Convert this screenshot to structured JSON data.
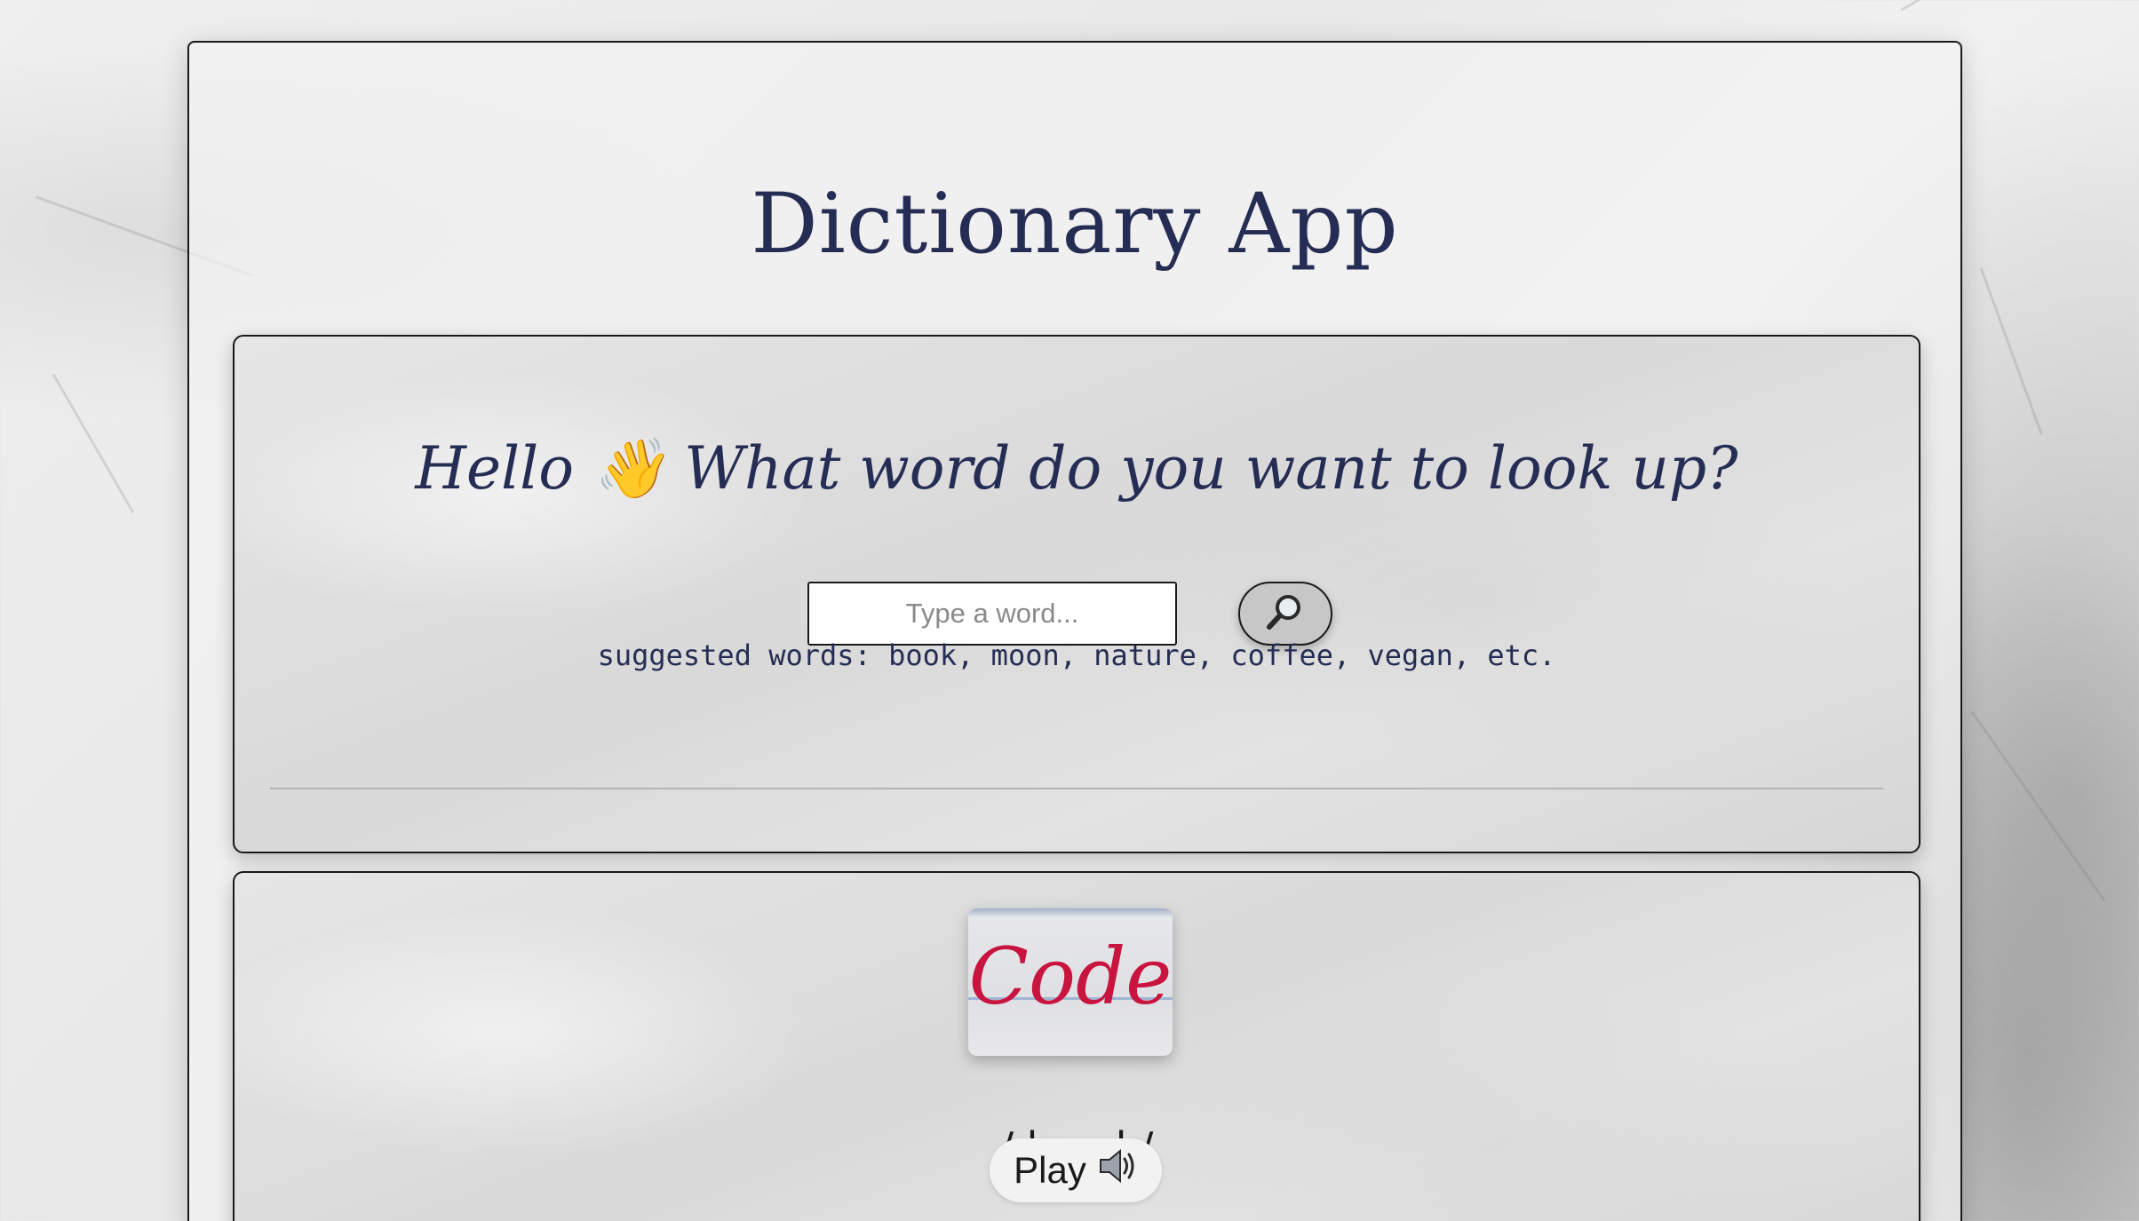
{
  "app": {
    "title": "Dictionary App"
  },
  "search": {
    "greeting": "Hello 👋 What word do you want to look up?",
    "placeholder": "Type a word...",
    "value": "",
    "button_icon": "search-icon",
    "suggestions": "suggested words: book, moon, nature, coffee, vegan, etc."
  },
  "result": {
    "word": "Code",
    "phonetic": "/ kəʊd /",
    "play_label": "Play",
    "play_icon": "speaker-icon"
  },
  "colors": {
    "title": "#262d54",
    "word": "#c8143e",
    "border": "#1a1a1a"
  }
}
